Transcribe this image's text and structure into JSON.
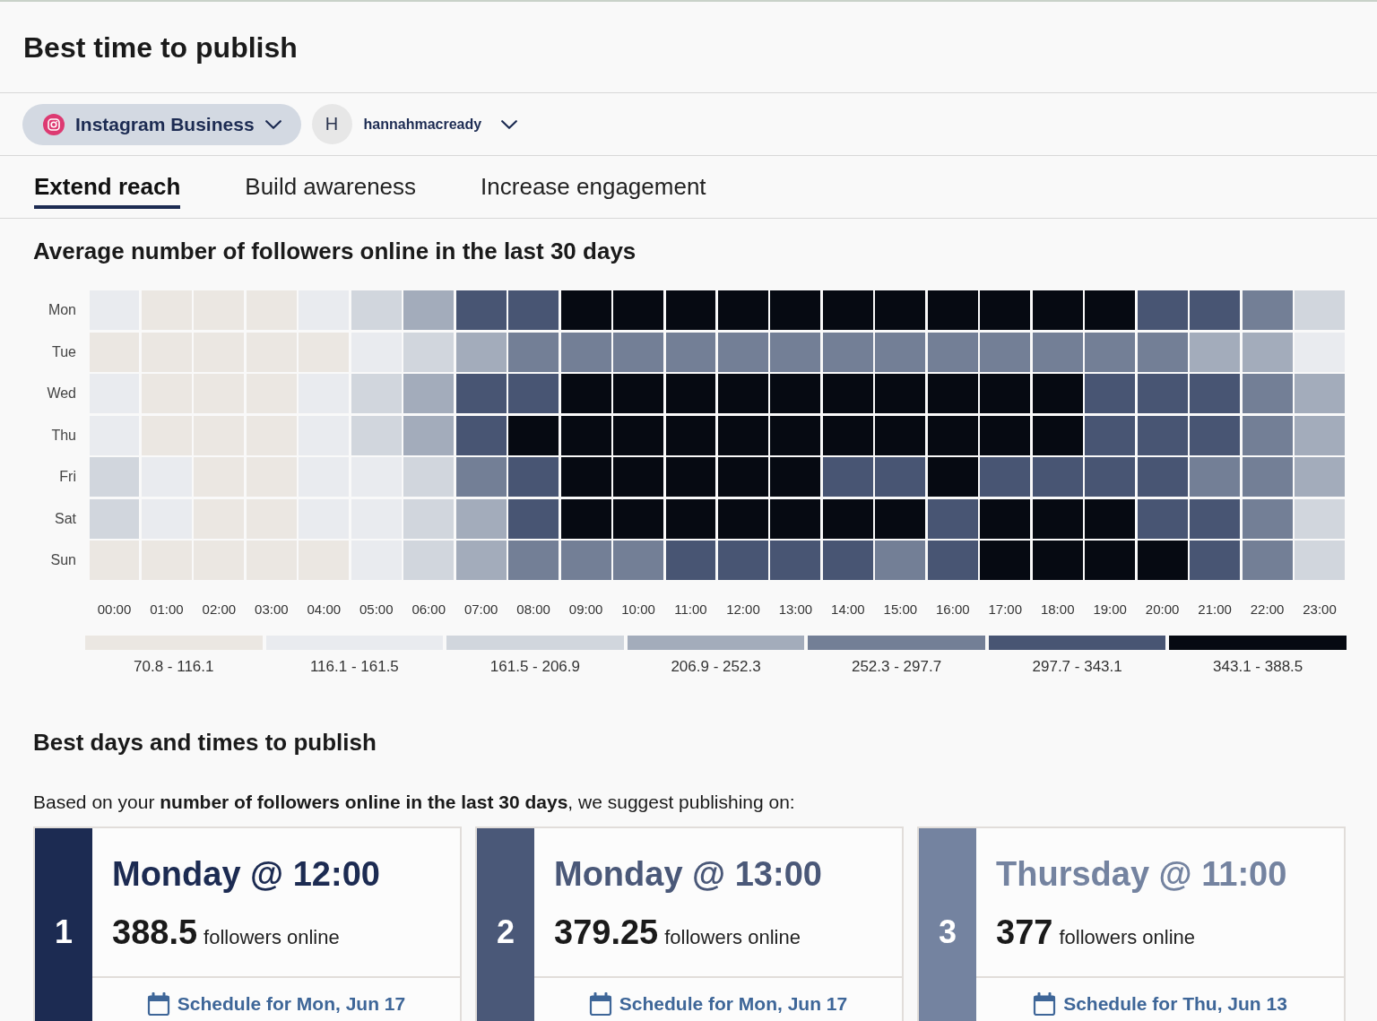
{
  "page": {
    "title": "Best time to publish"
  },
  "account_bar": {
    "network": {
      "label": "Instagram Business"
    },
    "account": {
      "avatar_letter": "H",
      "name": "hannahmacready"
    }
  },
  "tabs": [
    {
      "label": "Extend reach",
      "selected": true
    },
    {
      "label": "Build awareness",
      "selected": false
    },
    {
      "label": "Increase engagement",
      "selected": false
    }
  ],
  "heatmap": {
    "title": "Average number of followers online in the last 30 days",
    "rows": [
      {
        "day": "Mon",
        "cells": [
          {
            "color": "#e9ebef"
          },
          {
            "color": "#ebe7e2"
          },
          {
            "color": "#ebe7e2"
          },
          {
            "color": "#ebe7e2"
          },
          {
            "color": "#e9ebef"
          },
          {
            "color": "#d1d6dd"
          },
          {
            "color": "#a3acbb"
          },
          {
            "color": "#485573"
          },
          {
            "color": "#485573"
          },
          {
            "color": "#060a12"
          },
          {
            "color": "#060a12"
          },
          {
            "color": "#060a12"
          },
          {
            "color": "#060a12"
          },
          {
            "color": "#060a12"
          },
          {
            "color": "#060a12"
          },
          {
            "color": "#060a12"
          },
          {
            "color": "#060a12"
          },
          {
            "color": "#060a12"
          },
          {
            "color": "#060a12"
          },
          {
            "color": "#060a12"
          },
          {
            "color": "#485573"
          },
          {
            "color": "#485573"
          },
          {
            "color": "#737f96"
          },
          {
            "color": "#d1d6dd"
          }
        ]
      },
      {
        "day": "Tue",
        "cells": [
          {
            "color": "#ebe7e2"
          },
          {
            "color": "#ebe7e2"
          },
          {
            "color": "#ebe7e2"
          },
          {
            "color": "#ebe7e2"
          },
          {
            "color": "#ebe7e2"
          },
          {
            "color": "#e9ebef"
          },
          {
            "color": "#d1d6dd"
          },
          {
            "color": "#a3acbb"
          },
          {
            "color": "#737f96"
          },
          {
            "color": "#737f96"
          },
          {
            "color": "#737f96"
          },
          {
            "color": "#737f96"
          },
          {
            "color": "#737f96"
          },
          {
            "color": "#737f96"
          },
          {
            "color": "#737f96"
          },
          {
            "color": "#737f96"
          },
          {
            "color": "#737f96"
          },
          {
            "color": "#737f96"
          },
          {
            "color": "#737f96"
          },
          {
            "color": "#737f96"
          },
          {
            "color": "#737f96"
          },
          {
            "color": "#a3acbb"
          },
          {
            "color": "#a3acbb"
          },
          {
            "color": "#e9ebef"
          }
        ]
      },
      {
        "day": "Wed",
        "cells": [
          {
            "color": "#e9ebef"
          },
          {
            "color": "#ebe7e2"
          },
          {
            "color": "#ebe7e2"
          },
          {
            "color": "#ebe7e2"
          },
          {
            "color": "#e9ebef"
          },
          {
            "color": "#d1d6dd"
          },
          {
            "color": "#a3acbb"
          },
          {
            "color": "#485573"
          },
          {
            "color": "#485573"
          },
          {
            "color": "#060a12"
          },
          {
            "color": "#060a12"
          },
          {
            "color": "#060a12"
          },
          {
            "color": "#060a12"
          },
          {
            "color": "#060a12"
          },
          {
            "color": "#060a12"
          },
          {
            "color": "#060a12"
          },
          {
            "color": "#060a12"
          },
          {
            "color": "#060a12"
          },
          {
            "color": "#060a12"
          },
          {
            "color": "#485573"
          },
          {
            "color": "#485573"
          },
          {
            "color": "#485573"
          },
          {
            "color": "#737f96"
          },
          {
            "color": "#a3acbb"
          }
        ]
      },
      {
        "day": "Thu",
        "cells": [
          {
            "color": "#e9ebef"
          },
          {
            "color": "#ebe7e2"
          },
          {
            "color": "#ebe7e2"
          },
          {
            "color": "#ebe7e2"
          },
          {
            "color": "#e9ebef"
          },
          {
            "color": "#d1d6dd"
          },
          {
            "color": "#a3acbb"
          },
          {
            "color": "#485573"
          },
          {
            "color": "#060a12"
          },
          {
            "color": "#060a12"
          },
          {
            "color": "#060a12"
          },
          {
            "color": "#060a12"
          },
          {
            "color": "#060a12"
          },
          {
            "color": "#060a12"
          },
          {
            "color": "#060a12"
          },
          {
            "color": "#060a12"
          },
          {
            "color": "#060a12"
          },
          {
            "color": "#060a12"
          },
          {
            "color": "#060a12"
          },
          {
            "color": "#485573"
          },
          {
            "color": "#485573"
          },
          {
            "color": "#485573"
          },
          {
            "color": "#737f96"
          },
          {
            "color": "#a3acbb"
          }
        ]
      },
      {
        "day": "Fri",
        "cells": [
          {
            "color": "#d1d6dd"
          },
          {
            "color": "#e9ebef"
          },
          {
            "color": "#ebe7e2"
          },
          {
            "color": "#ebe7e2"
          },
          {
            "color": "#e9ebef"
          },
          {
            "color": "#e9ebef"
          },
          {
            "color": "#d1d6dd"
          },
          {
            "color": "#737f96"
          },
          {
            "color": "#485573"
          },
          {
            "color": "#060a12"
          },
          {
            "color": "#060a12"
          },
          {
            "color": "#060a12"
          },
          {
            "color": "#060a12"
          },
          {
            "color": "#060a12"
          },
          {
            "color": "#485573"
          },
          {
            "color": "#485573"
          },
          {
            "color": "#060a12"
          },
          {
            "color": "#485573"
          },
          {
            "color": "#485573"
          },
          {
            "color": "#485573"
          },
          {
            "color": "#485573"
          },
          {
            "color": "#737f96"
          },
          {
            "color": "#737f96"
          },
          {
            "color": "#a3acbb"
          }
        ]
      },
      {
        "day": "Sat",
        "cells": [
          {
            "color": "#d1d6dd"
          },
          {
            "color": "#e9ebef"
          },
          {
            "color": "#ebe7e2"
          },
          {
            "color": "#ebe7e2"
          },
          {
            "color": "#e9ebef"
          },
          {
            "color": "#e9ebef"
          },
          {
            "color": "#d1d6dd"
          },
          {
            "color": "#a3acbb"
          },
          {
            "color": "#485573"
          },
          {
            "color": "#060a12"
          },
          {
            "color": "#060a12"
          },
          {
            "color": "#060a12"
          },
          {
            "color": "#060a12"
          },
          {
            "color": "#060a12"
          },
          {
            "color": "#060a12"
          },
          {
            "color": "#060a12"
          },
          {
            "color": "#485573"
          },
          {
            "color": "#060a12"
          },
          {
            "color": "#060a12"
          },
          {
            "color": "#060a12"
          },
          {
            "color": "#485573"
          },
          {
            "color": "#485573"
          },
          {
            "color": "#737f96"
          },
          {
            "color": "#d1d6dd"
          }
        ]
      },
      {
        "day": "Sun",
        "cells": [
          {
            "color": "#ebe7e2"
          },
          {
            "color": "#ebe7e2"
          },
          {
            "color": "#ebe7e2"
          },
          {
            "color": "#ebe7e2"
          },
          {
            "color": "#ebe7e2"
          },
          {
            "color": "#e9ebef"
          },
          {
            "color": "#d1d6dd"
          },
          {
            "color": "#a3acbb"
          },
          {
            "color": "#737f96"
          },
          {
            "color": "#737f96"
          },
          {
            "color": "#737f96"
          },
          {
            "color": "#485573"
          },
          {
            "color": "#485573"
          },
          {
            "color": "#485573"
          },
          {
            "color": "#485573"
          },
          {
            "color": "#737f96"
          },
          {
            "color": "#485573"
          },
          {
            "color": "#060a12"
          },
          {
            "color": "#060a12"
          },
          {
            "color": "#060a12"
          },
          {
            "color": "#060a12"
          },
          {
            "color": "#485573"
          },
          {
            "color": "#737f96"
          },
          {
            "color": "#d1d6dd"
          }
        ]
      }
    ],
    "hours": [
      "00:00",
      "01:00",
      "02:00",
      "03:00",
      "04:00",
      "05:00",
      "06:00",
      "07:00",
      "08:00",
      "09:00",
      "10:00",
      "11:00",
      "12:00",
      "13:00",
      "14:00",
      "15:00",
      "16:00",
      "17:00",
      "18:00",
      "19:00",
      "20:00",
      "21:00",
      "22:00",
      "23:00"
    ],
    "legend": [
      {
        "label": "70.8 - 116.1",
        "color": "#ebe7e2"
      },
      {
        "label": "116.1 - 161.5",
        "color": "#e9ebef"
      },
      {
        "label": "161.5 - 206.9",
        "color": "#d1d6dd"
      },
      {
        "label": "206.9 - 252.3",
        "color": "#a3acbb"
      },
      {
        "label": "252.3 - 297.7",
        "color": "#737f96"
      },
      {
        "label": "297.7 - 343.1",
        "color": "#485573"
      },
      {
        "label": "343.1 - 388.5",
        "color": "#060a12"
      }
    ]
  },
  "suggestions": {
    "title": "Best days and times to publish",
    "intro": "Based on your **number of followers online in the last 30 days**, we suggest publishing on:",
    "cards": [
      {
        "rank": "1",
        "color": "#1c2b52",
        "title": "Monday @ 12:00",
        "count": "388.5",
        "count_label": "followers online",
        "link": "Schedule for Mon, Jun 17"
      },
      {
        "rank": "2",
        "color": "#4a5878",
        "title": "Monday @ 13:00",
        "count": "379.25",
        "count_label": "followers online",
        "link": "Schedule for Mon, Jun 17"
      },
      {
        "rank": "3",
        "color": "#7483a0",
        "title": "Thursday @ 11:00",
        "count": "377",
        "count_label": "followers online",
        "link": "Schedule for Thu, Jun 13"
      }
    ]
  }
}
